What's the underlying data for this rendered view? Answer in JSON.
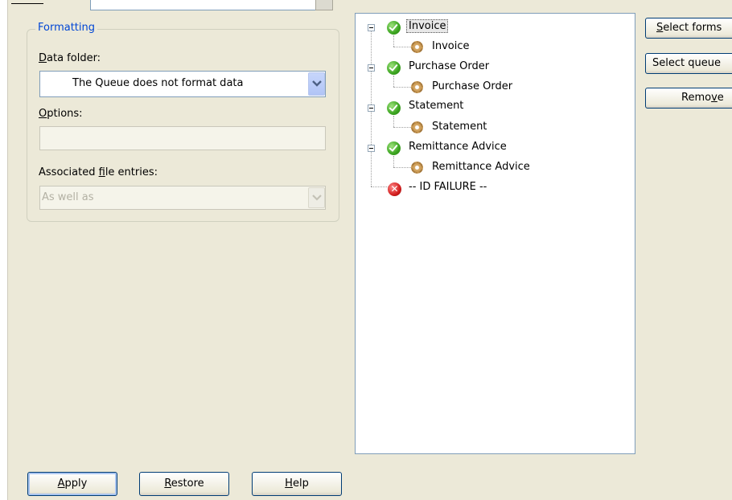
{
  "formatting": {
    "group_title": "Formatting",
    "data_folder_label": "Data folder:",
    "data_folder_value": "The Queue does not format data",
    "options_label": "Options:",
    "options_value": "",
    "associated_label": "Associated file entries:",
    "associated_value": "As well as"
  },
  "tree": {
    "nodes": [
      {
        "label": "Invoice",
        "child": "Invoice",
        "status": "ok"
      },
      {
        "label": "Purchase Order",
        "child": "Purchase Order",
        "status": "ok"
      },
      {
        "label": "Statement",
        "child": "Statement",
        "status": "ok"
      },
      {
        "label": "Remittance Advice",
        "child": "Remittance Advice",
        "status": "ok"
      }
    ],
    "failure_label": "-- ID FAILURE --"
  },
  "side_buttons": {
    "select_forms": "Select forms",
    "select_queue": "Select queue",
    "remove": "Remove"
  },
  "bottom_buttons": {
    "apply": "Apply",
    "restore": "Restore",
    "help": "Help"
  }
}
